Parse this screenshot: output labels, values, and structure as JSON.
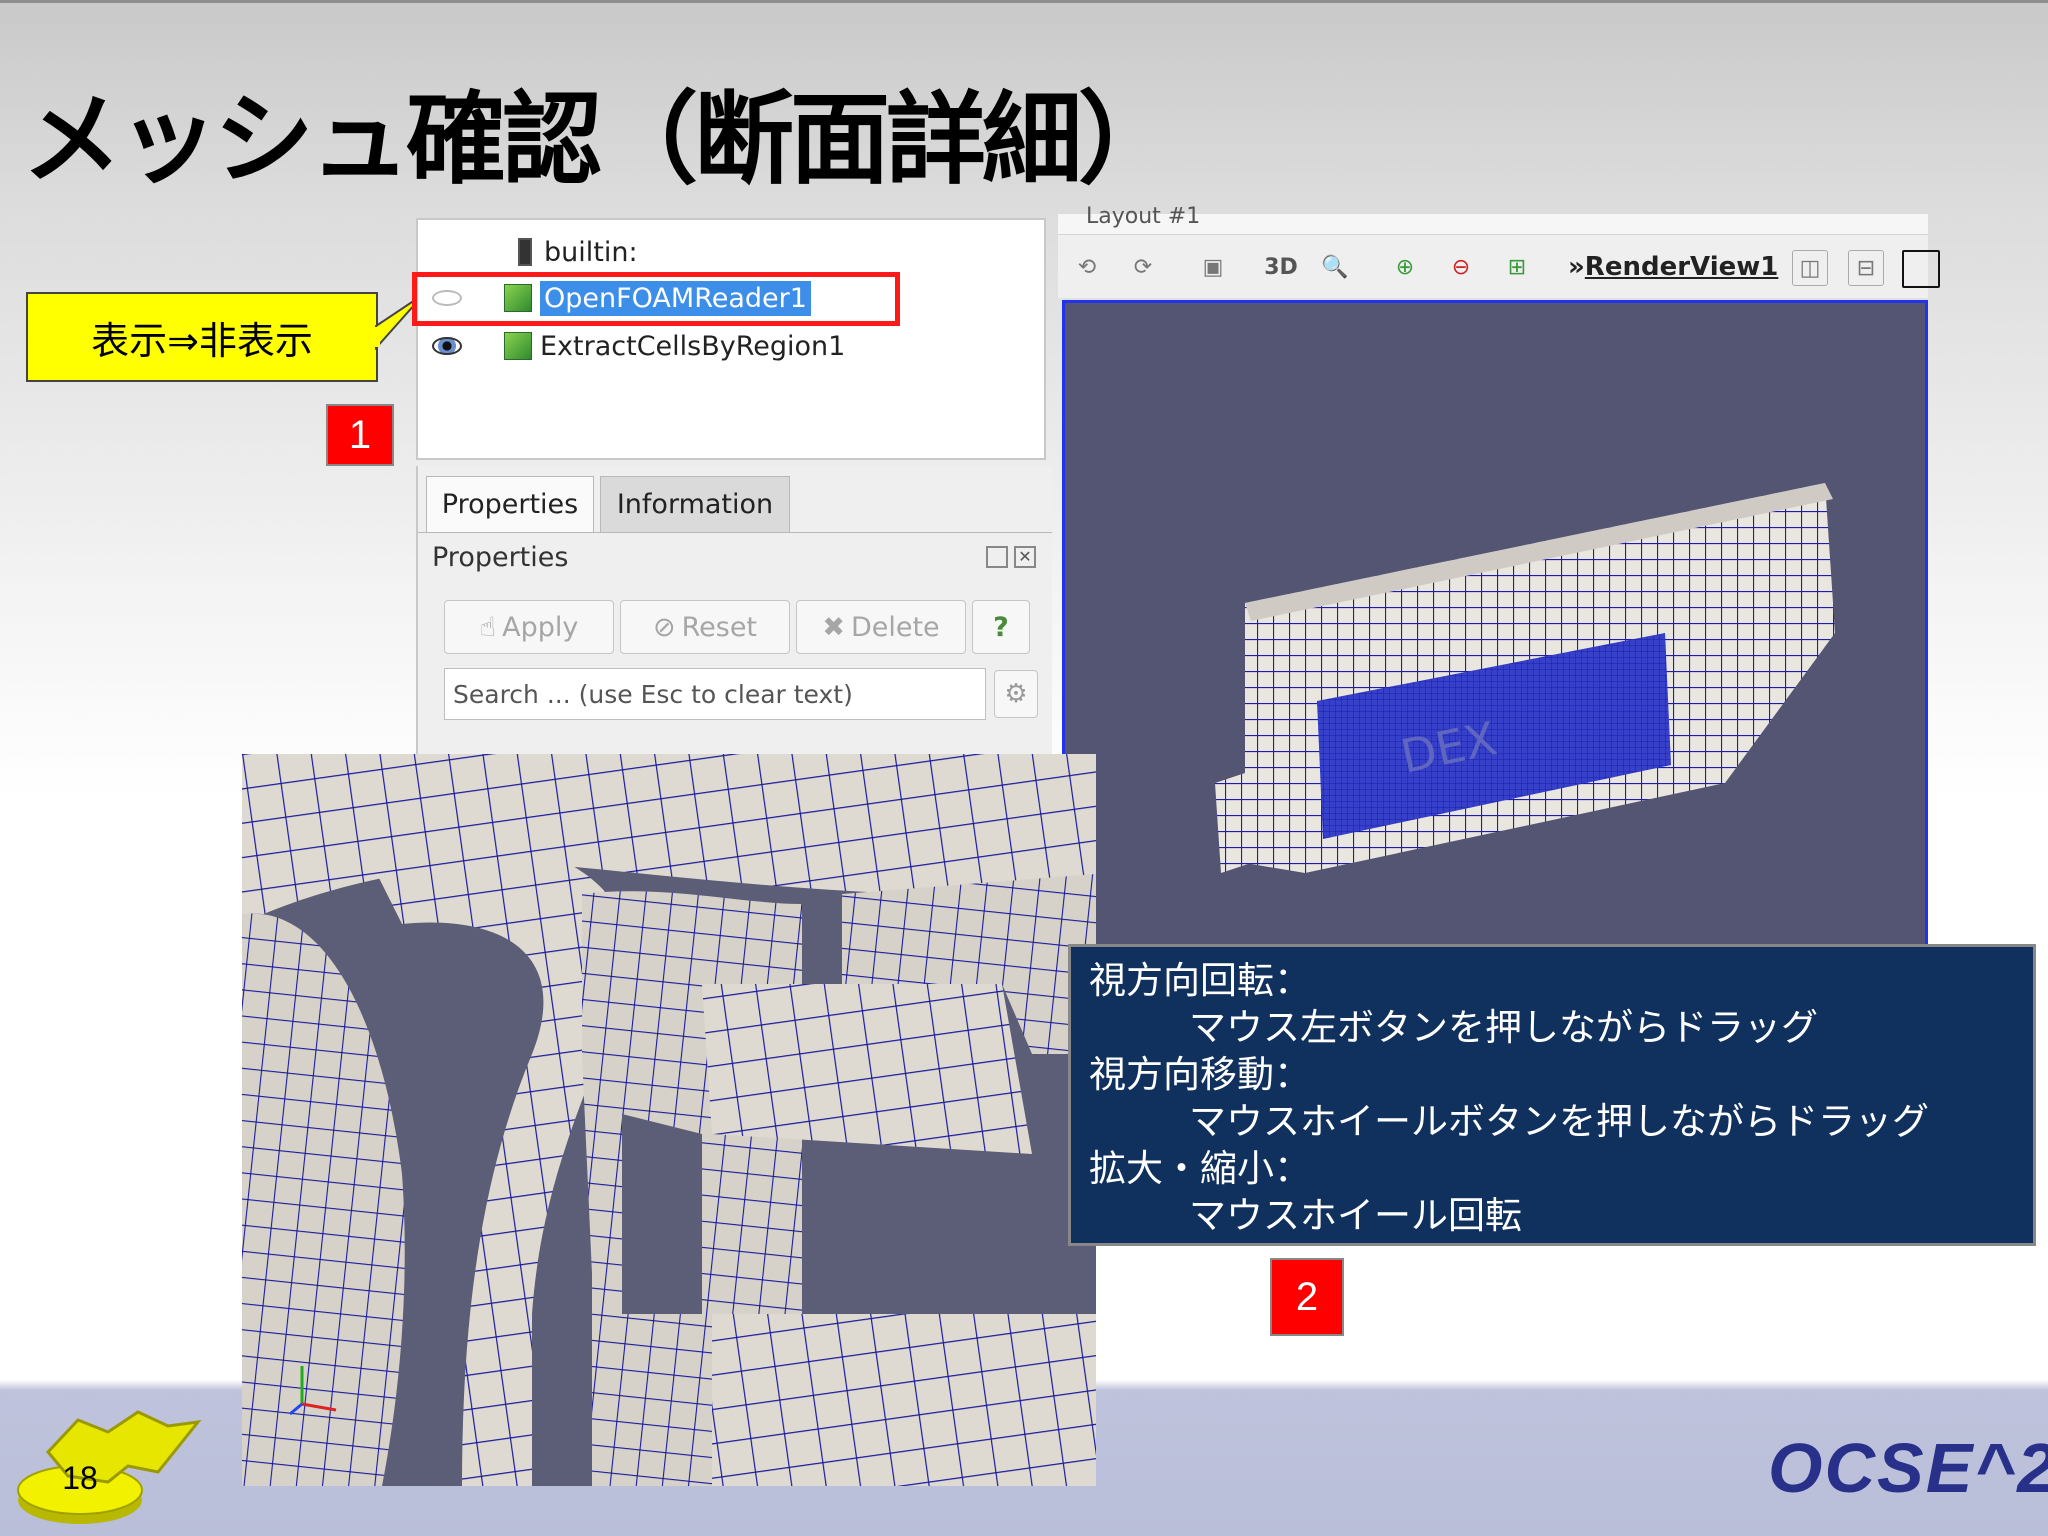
{
  "slide": {
    "title": "メッシュ確認（断面詳細）",
    "page_number": "18",
    "logo_text": "OCSE^2",
    "callout": "表示⇒非表示",
    "badge_1": "1",
    "badge_2": "2"
  },
  "pipeline": {
    "items": [
      {
        "label": "builtin:",
        "visible": null
      },
      {
        "label": "OpenFOAMReader1",
        "visible": false,
        "selected": true
      },
      {
        "label": "ExtractCellsByRegion1",
        "visible": true
      }
    ]
  },
  "properties_panel": {
    "tabs": [
      "Properties",
      "Information"
    ],
    "active_tab": "Properties",
    "header": "Properties",
    "buttons": {
      "apply": "Apply",
      "reset": "Reset",
      "delete": "Delete",
      "help": "?"
    },
    "search_placeholder": "Search ... (use Esc to clear text)"
  },
  "render_view": {
    "layout_tab": "Layout #1",
    "mode_3d": "3D",
    "view_name": "RenderView1",
    "chevron": "»",
    "mesh_text": "DEX"
  },
  "instructions": {
    "rotate_title": "視方向回転：",
    "rotate_desc": "マウス左ボタンを押しながらドラッグ",
    "pan_title": "視方向移動：",
    "pan_desc": "マウスホイールボタンを押しながらドラッグ",
    "zoom_title": "拡大・縮小：",
    "zoom_desc": "マウスホイール回転"
  },
  "colors": {
    "callout_bg": "#ffff00",
    "badge_bg": "#ff0000",
    "selection": "#3d8ee8",
    "highlight": "#ff1a1a",
    "render_bg": "#545572",
    "mesh_line": "#1c1cb0",
    "info_bg": "#10315e",
    "logo": "#28308a"
  }
}
